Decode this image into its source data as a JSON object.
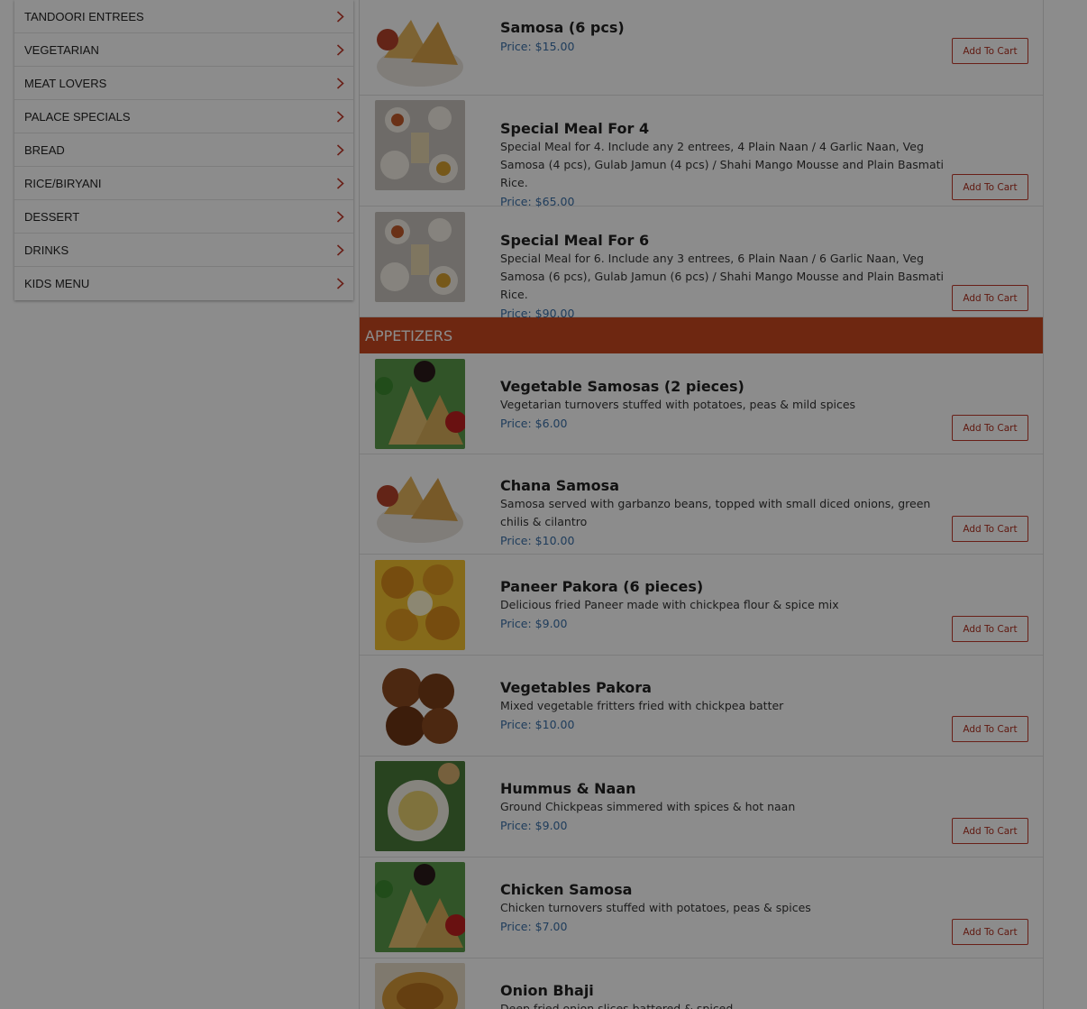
{
  "sidebar": {
    "items": [
      {
        "label": "TANDOORI ENTREES"
      },
      {
        "label": "VEGETARIAN"
      },
      {
        "label": "MEAT LOVERS"
      },
      {
        "label": "PALACE SPECIALS"
      },
      {
        "label": "BREAD"
      },
      {
        "label": "RICE/BIRYANI"
      },
      {
        "label": "DESSERT"
      },
      {
        "label": "DRINKS"
      },
      {
        "label": "KIDS MENU"
      }
    ]
  },
  "menu": {
    "add_to_cart_label": "Add To Cart",
    "top_items": [
      {
        "title": "Samosa (6 pcs)",
        "desc": "",
        "price": "Price: $15.00",
        "image": "samosa-plate"
      },
      {
        "title": "Special Meal For 4",
        "desc": "Special Meal for 4. Include any 2 entrees, 4 Plain Naan / 4 Garlic Naan, Veg Samosa (4 pcs), Gulab Jamun (4 pcs) / Shahi Mango Mousse and Plain Basmati Rice.",
        "price": "Price: $65.00",
        "image": "meal-spread"
      },
      {
        "title": "Special Meal For 6",
        "desc": "Special Meal for 6. Include any 3 entrees, 6 Plain Naan / 6 Garlic Naan, Veg Samosa (6 pcs), Gulab Jamun (6 pcs) / Shahi Mango Mousse and Plain Basmati Rice.",
        "price": "Price: $90.00",
        "image": "meal-spread"
      }
    ],
    "section": {
      "title": "APPETIZERS"
    },
    "appetizers": [
      {
        "title": "Vegetable Samosas (2 pieces)",
        "desc": "Vegetarian turnovers stuffed with potatoes, peas & mild spices",
        "price": "Price: $6.00",
        "image": "samosa-sauces"
      },
      {
        "title": "Chana Samosa",
        "desc": "Samosa served with garbanzo beans, topped with small diced onions, green chilis & cilantro",
        "price": "Price: $10.00",
        "image": "samosa-plate"
      },
      {
        "title": "Paneer Pakora (6 pieces)",
        "desc": "Delicious fried Paneer made with chickpea flour & spice mix",
        "price": "Price: $9.00",
        "image": "paneer-pakora"
      },
      {
        "title": "Vegetables Pakora",
        "desc": "Mixed vegetable fritters fried with chickpea batter",
        "price": "Price: $10.00",
        "image": "veg-pakora"
      },
      {
        "title": "Hummus & Naan",
        "desc": "Ground Chickpeas simmered with spices & hot naan",
        "price": "Price: $9.00",
        "image": "hummus"
      },
      {
        "title": "Chicken Samosa",
        "desc": "Chicken turnovers stuffed with potatoes, peas & spices",
        "price": "Price: $7.00",
        "image": "samosa-sauces"
      },
      {
        "title": "Onion Bhaji",
        "desc": "Deep fried onion slices battered & spiced",
        "price": "",
        "image": "onion-bhaji"
      }
    ]
  },
  "colors": {
    "section_header": "#c8471f",
    "price_text": "#3a6fa8",
    "button_border": "#c0392b",
    "modal_overlay": "rgba(0,0,0,0.45)"
  }
}
